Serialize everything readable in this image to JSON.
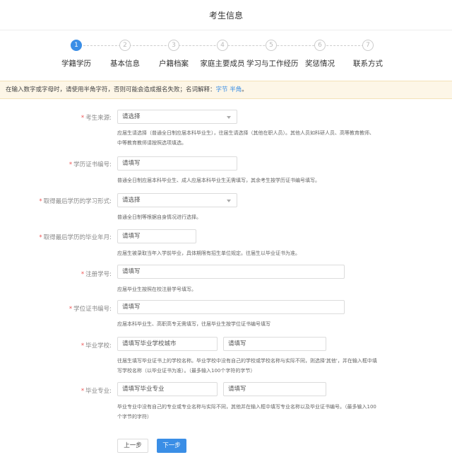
{
  "page": {
    "title": "考生信息"
  },
  "steps": [
    {
      "num": "1",
      "label": "学籍学历",
      "active": true
    },
    {
      "num": "2",
      "label": "基本信息",
      "active": false
    },
    {
      "num": "3",
      "label": "户籍档案",
      "active": false
    },
    {
      "num": "4",
      "label": "家庭主要成员",
      "active": false
    },
    {
      "num": "5",
      "label": "学习与工作经历",
      "active": false
    },
    {
      "num": "6",
      "label": "奖惩情况",
      "active": false
    },
    {
      "num": "7",
      "label": "联系方式",
      "active": false
    }
  ],
  "notice": {
    "text": "在输入数字或字母时，请使用半角字符，否则可能会造成报名失败；名词解释：",
    "link1": "字节",
    "link2": "半角",
    "tail": "。"
  },
  "form": {
    "source": {
      "label": "考生来源:",
      "value": "请选择",
      "hint": "应届生请选择（普通全日制应届本科毕业生），往届生请选择（其他在职人员）。其他人员如科研人员、高等教育教师、中等教育教师请按照选项填选。"
    },
    "cert_no": {
      "label": "学历证书编号:",
      "placeholder": "请填写",
      "hint": "普通全日制应届本科毕业生、成人应届本科毕业生无需填写，其余考生按学历证书编号填写。"
    },
    "study_form": {
      "label": "取得最后学历的学习形式:",
      "value": "请选择",
      "hint": "普通全日制等根据自身情况进行选择。"
    },
    "grad_date": {
      "label": "取得最后学历的毕业年月:",
      "placeholder": "请填写",
      "hint": "应届生被录取当年入学前毕业，具体期限有招生单位规定。往届生以毕业证书为准。"
    },
    "reg_no": {
      "label": "注册学号:",
      "placeholder": "请填写",
      "hint": "应届毕业生按照在校注册学号填写。"
    },
    "degree_no": {
      "label": "学位证书编号:",
      "placeholder": "请填写",
      "hint": "应届本科毕业生、高职高专无需填写，往届毕业生按学位证书编号填写"
    },
    "school": {
      "label": "毕业学校:",
      "placeholder_city": "请填写毕业学校城市",
      "placeholder_name": "请填写",
      "hint": "往届生填写毕业证书上的学校名称。毕业学校中没有自己的学校或学校名称与实际不同，则选择'其他'，并在输入框中填写学校名称（以毕业证书为准）。（最多输入100个字符的字节）"
    },
    "major": {
      "label": "毕业专业:",
      "placeholder_major": "请填写毕业专业",
      "placeholder_name": "请填写",
      "hint": "毕业专业中没有自己的专业或专业名称与实际不同，其他并在输入框中填写专业名称以及毕业证书编号。（最多输入100个字节的字符）"
    }
  },
  "buttons": {
    "prev": "上一步",
    "next": "下一步"
  },
  "colors": {
    "accent": "#3a8ee6",
    "notice_bg": "#fdf6e7",
    "required": "#e55555"
  }
}
